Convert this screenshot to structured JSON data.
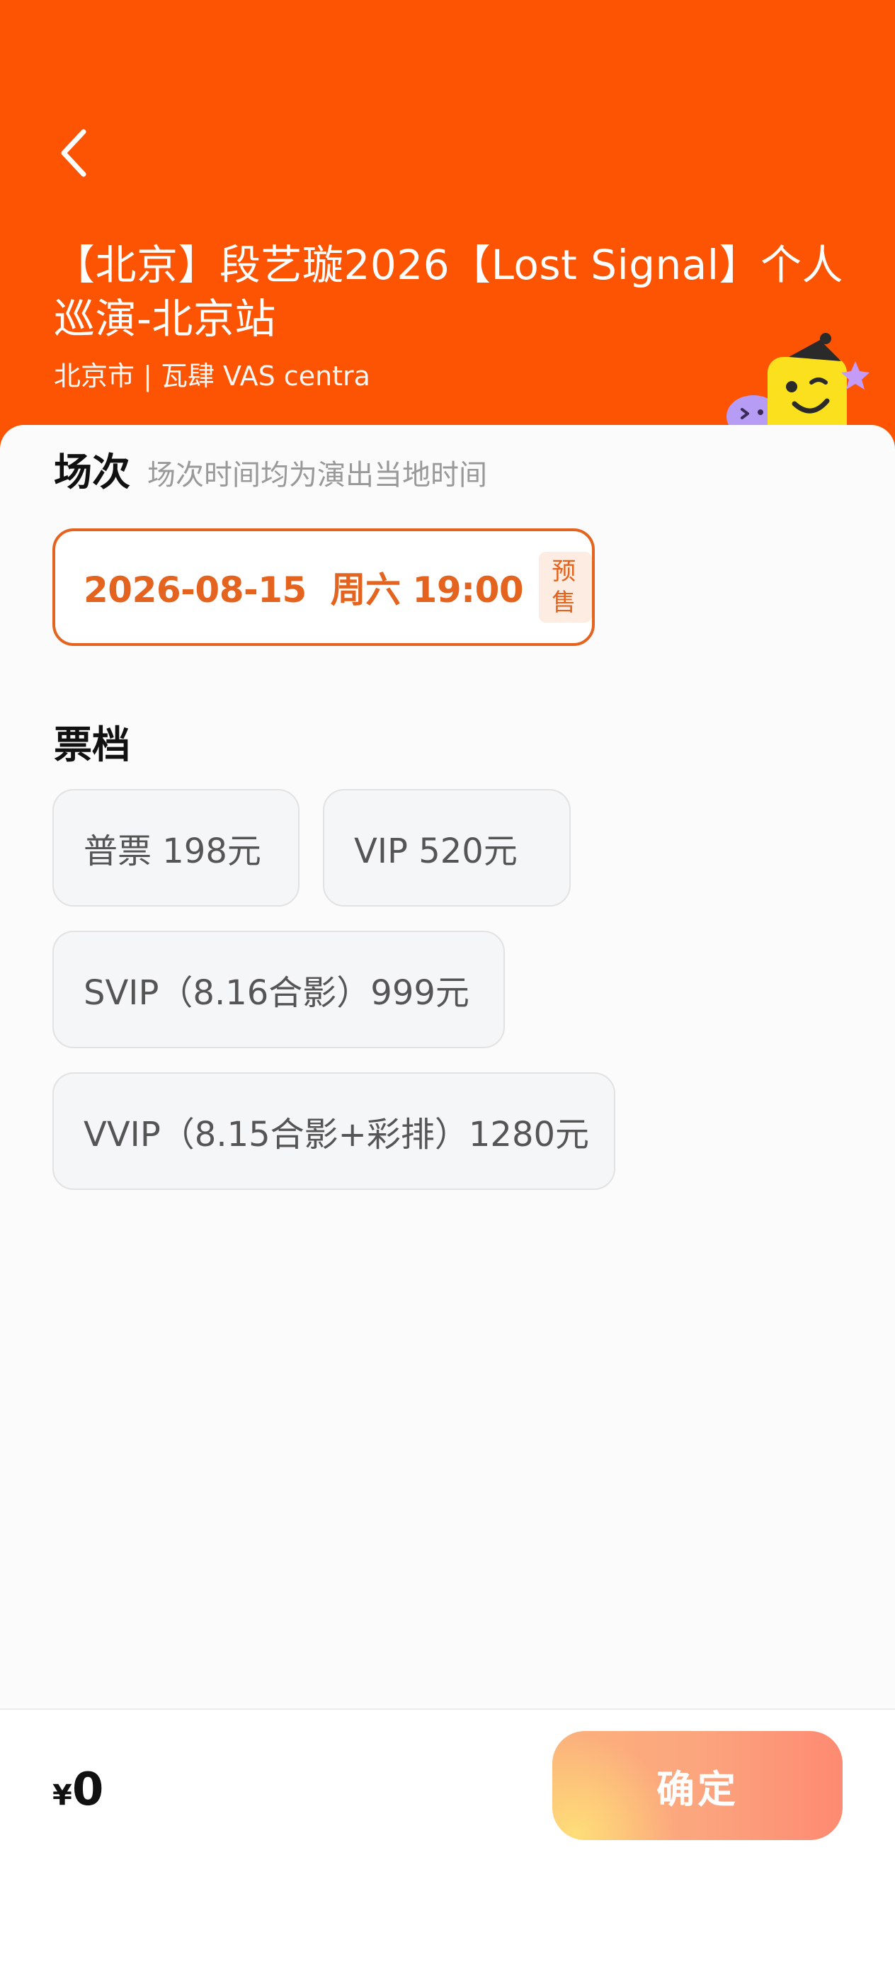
{
  "header": {
    "title": "【北京】段艺璇2026【Lost Signal】个人巡演-北京站",
    "venue": "北京市 | 瓦肆 VAS centra"
  },
  "session": {
    "section_title": "场次",
    "section_hint": "场次时间均为演出当地时间",
    "selected": "2026-08-15  周六 19:00",
    "badge": "预售"
  },
  "tiers": {
    "section_title": "票档",
    "items": [
      {
        "label": "普票 198元"
      },
      {
        "label": "VIP 520元"
      },
      {
        "label": "SVIP（8.16合影）999元"
      },
      {
        "label": "VVIP（8.15合影+彩排）1280元"
      }
    ]
  },
  "footer": {
    "currency": "¥",
    "amount": "0",
    "confirm_label": "确定"
  },
  "colors": {
    "header_bg": "#fd5404",
    "accent": "#e4631f",
    "badge_bg": "#fdece1"
  },
  "icons": [
    "back-arrow-icon",
    "mascot-illustration"
  ]
}
